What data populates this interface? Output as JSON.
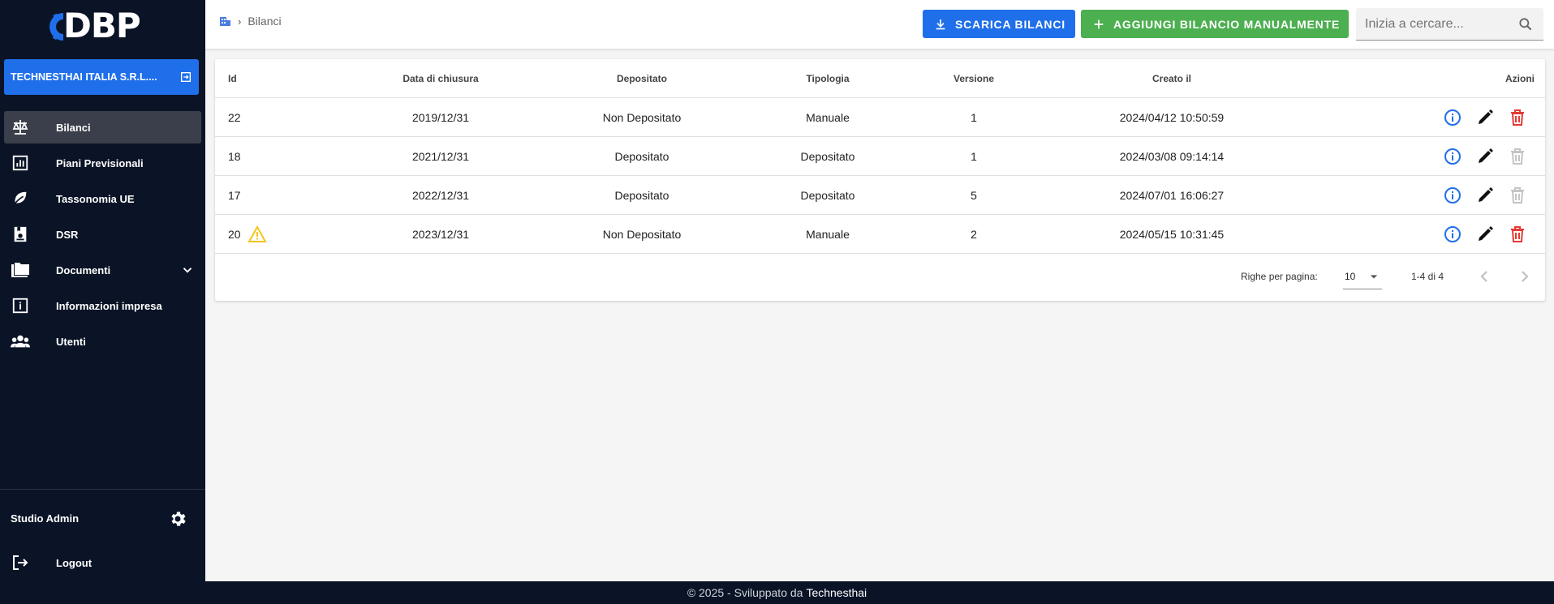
{
  "app": {
    "logo_text": "DBP"
  },
  "sidebar": {
    "company": "TECHNESTHAI ITALIA S.R.L....",
    "items": [
      {
        "label": "Bilanci",
        "icon": "balance-scale-icon",
        "active": true
      },
      {
        "label": "Piani Previsionali",
        "icon": "bar-chart-icon"
      },
      {
        "label": "Tassonomia UE",
        "icon": "leaf-icon"
      },
      {
        "label": "DSR",
        "icon": "report-icon"
      },
      {
        "label": "Documenti",
        "icon": "folder-icon",
        "expandable": true
      },
      {
        "label": "Informazioni impresa",
        "icon": "info-square-icon"
      },
      {
        "label": "Utenti",
        "icon": "users-icon"
      }
    ],
    "user": "Studio Admin",
    "logout": "Logout"
  },
  "header": {
    "breadcrumb": "Bilanci",
    "download_label": "SCARICA BILANCI",
    "add_label": "AGGIUNGI BILANCIO MANUALMENTE",
    "search_placeholder": "Inizia a cercare..."
  },
  "table": {
    "columns": [
      "Id",
      "Data di chiusura",
      "Depositato",
      "Tipologia",
      "Versione",
      "Creato il",
      "Azioni"
    ],
    "rows": [
      {
        "id": "22",
        "data": "2019/12/31",
        "depositato": "Non Depositato",
        "tipologia": "Manuale",
        "versione": "1",
        "creato": "2024/04/12 10:50:59",
        "warning": false,
        "delete_enabled": true
      },
      {
        "id": "18",
        "data": "2021/12/31",
        "depositato": "Depositato",
        "tipologia": "Depositato",
        "versione": "1",
        "creato": "2024/03/08 09:14:14",
        "warning": false,
        "delete_enabled": false
      },
      {
        "id": "17",
        "data": "2022/12/31",
        "depositato": "Depositato",
        "tipologia": "Depositato",
        "versione": "5",
        "creato": "2024/07/01 16:06:27",
        "warning": false,
        "delete_enabled": false
      },
      {
        "id": "20",
        "data": "2023/12/31",
        "depositato": "Non Depositato",
        "tipologia": "Manuale",
        "versione": "2",
        "creato": "2024/05/15 10:31:45",
        "warning": true,
        "delete_enabled": true
      }
    ],
    "pagination": {
      "rows_per_page_label": "Righe per pagina:",
      "rows_per_page": "10",
      "range": "1-4 di 4"
    }
  },
  "footer": {
    "text": "© 2025 - Sviluppato da",
    "brand": "Technesthai"
  },
  "colors": {
    "primary": "#1f6feb",
    "success": "#4caf50",
    "danger": "#e53935",
    "sidebar": "#0b1426",
    "warning": "#f5c518"
  }
}
